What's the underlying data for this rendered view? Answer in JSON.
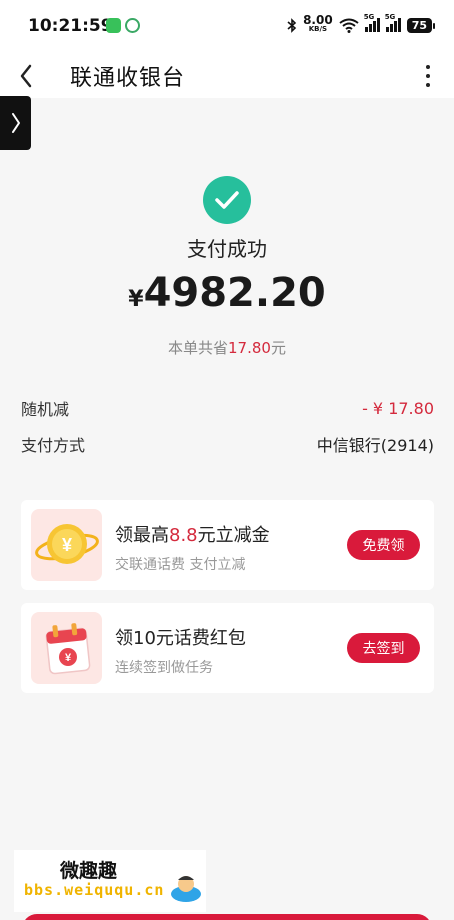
{
  "status_bar": {
    "time": "10:21:59",
    "net_speed": "8.00",
    "net_unit": "KB/S",
    "signal_tag": "5G",
    "battery": "75"
  },
  "header": {
    "back_icon": "chevron-left-icon",
    "title": "联通收银台",
    "more_icon": "more-vertical-icon"
  },
  "float_tab": {
    "icon": "chevron-right-icon"
  },
  "result": {
    "status_icon": "check-circle-icon",
    "title": "支付成功",
    "currency": "¥",
    "amount": "4982.20",
    "saved_prefix": "本单共省",
    "saved_amount": "17.80",
    "saved_suffix": "元"
  },
  "details": [
    {
      "label": "随机减",
      "value": "- ¥ 17.80"
    },
    {
      "label": "支付方式",
      "value": "中信银行(2914)"
    }
  ],
  "promos": [
    {
      "title_prefix": "领最高",
      "title_highlight": "8.8",
      "title_suffix": "元立减金",
      "subtitle": "交联通话费 支付立减",
      "button": "免费领",
      "icon": "gold-coin-icon"
    },
    {
      "title": "领10元话费红包",
      "subtitle": "连续签到做任务",
      "button": "去签到",
      "icon": "calendar-icon"
    }
  ],
  "watermark": {
    "cn": "微趣趣",
    "en": "bbs.weiququ.cn"
  },
  "colors": {
    "brand_red": "#d91a3b",
    "success_green": "#26bf9c",
    "highlight_red": "#d42a3d"
  }
}
